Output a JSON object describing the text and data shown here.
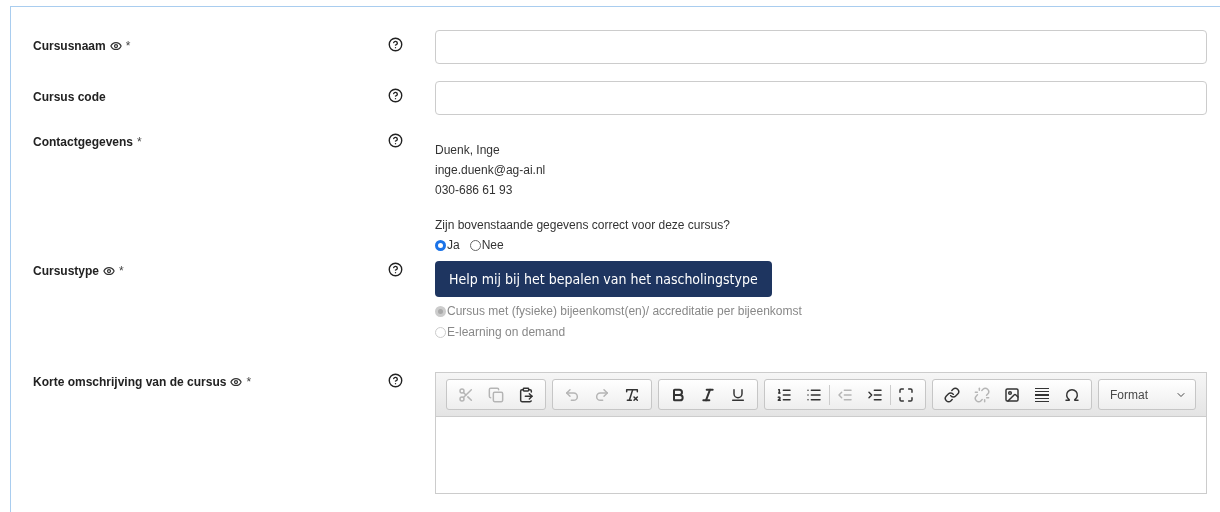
{
  "fields": [
    {
      "kind": "input",
      "label": "Cursusnaam",
      "public": true,
      "required_mark": "*"
    },
    {
      "kind": "input",
      "label": "Cursus code",
      "public": false
    },
    {
      "kind": "contact",
      "label": "Contactgegevens",
      "public": false,
      "required_mark": "*",
      "lines": [
        "Duenk, Inge",
        "inge.duenk@ag-ai.nl",
        "030-686 61 93"
      ],
      "question": "Zijn bovenstaande gegevens correct voor deze cursus?",
      "options": [
        {
          "label": "Ja",
          "selected": true
        },
        {
          "label": "Nee",
          "selected": false
        }
      ]
    },
    {
      "kind": "type",
      "label": "Cursustype",
      "public": true,
      "required_mark": "*",
      "button": "Help mij bij het bepalen van het nascholingstype",
      "options": [
        {
          "label": "Cursus met (fysieke) bijeenkomst(en)/ accreditatie per bijeenkomst",
          "selected": true,
          "disabled": true
        },
        {
          "label": "E-learning on demand",
          "selected": false,
          "disabled": true
        }
      ]
    },
    {
      "kind": "editor",
      "label": "Korte omschrijving van de cursus",
      "public": true,
      "required_mark": "*",
      "toolbar": [
        [
          {
            "kind": "cut",
            "disabled": true
          },
          {
            "kind": "copy",
            "disabled": true
          },
          {
            "kind": "paste",
            "disabled": false
          }
        ],
        [
          {
            "kind": "undo",
            "disabled": true
          },
          {
            "kind": "redo",
            "disabled": true
          },
          {
            "kind": "clear",
            "disabled": false
          }
        ],
        [
          {
            "kind": "bold",
            "disabled": false
          },
          {
            "kind": "italic",
            "disabled": false
          },
          {
            "kind": "underline",
            "disabled": false
          }
        ],
        [
          {
            "kind": "numbered",
            "disabled": false
          },
          {
            "kind": "bulleted",
            "disabled": false
          },
          {
            "kind": "outdent",
            "disabled": true
          },
          {
            "kind": "indent",
            "disabled": false
          },
          {
            "kind": "maximize",
            "disabled": false
          }
        ],
        [
          {
            "kind": "link",
            "disabled": false
          },
          {
            "kind": "unlink",
            "disabled": true
          },
          {
            "kind": "image",
            "disabled": false
          },
          {
            "kind": "rule",
            "disabled": false
          },
          {
            "kind": "symbol",
            "disabled": false
          }
        ]
      ],
      "format": "Format"
    }
  ]
}
